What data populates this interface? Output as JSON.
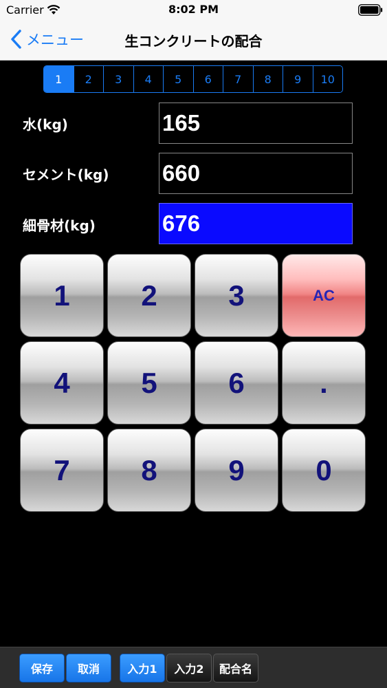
{
  "status": {
    "carrier": "Carrier",
    "time": "8:02 PM"
  },
  "nav": {
    "back_label": "メニュー",
    "title": "生コンクリートの配合"
  },
  "segments": [
    "1",
    "2",
    "3",
    "4",
    "5",
    "6",
    "7",
    "8",
    "9",
    "10"
  ],
  "selected_segment": "1",
  "fields": [
    {
      "label": "水(kg)",
      "value": "165",
      "active": false
    },
    {
      "label": "セメント(kg)",
      "value": "660",
      "active": false
    },
    {
      "label": "細骨材(kg)",
      "value": "676",
      "active": true
    }
  ],
  "keys": [
    "1",
    "2",
    "3",
    "AC",
    "4",
    "5",
    "6",
    ".",
    "7",
    "8",
    "9",
    "0"
  ],
  "toolbar": {
    "save": "保存",
    "cancel": "取消",
    "input1": "入力1",
    "input2": "入力2",
    "mix_name": "配合名"
  },
  "colors": {
    "accent": "#1a7cf5",
    "active_field": "#0a0aff",
    "ac_key": "#f18686"
  }
}
